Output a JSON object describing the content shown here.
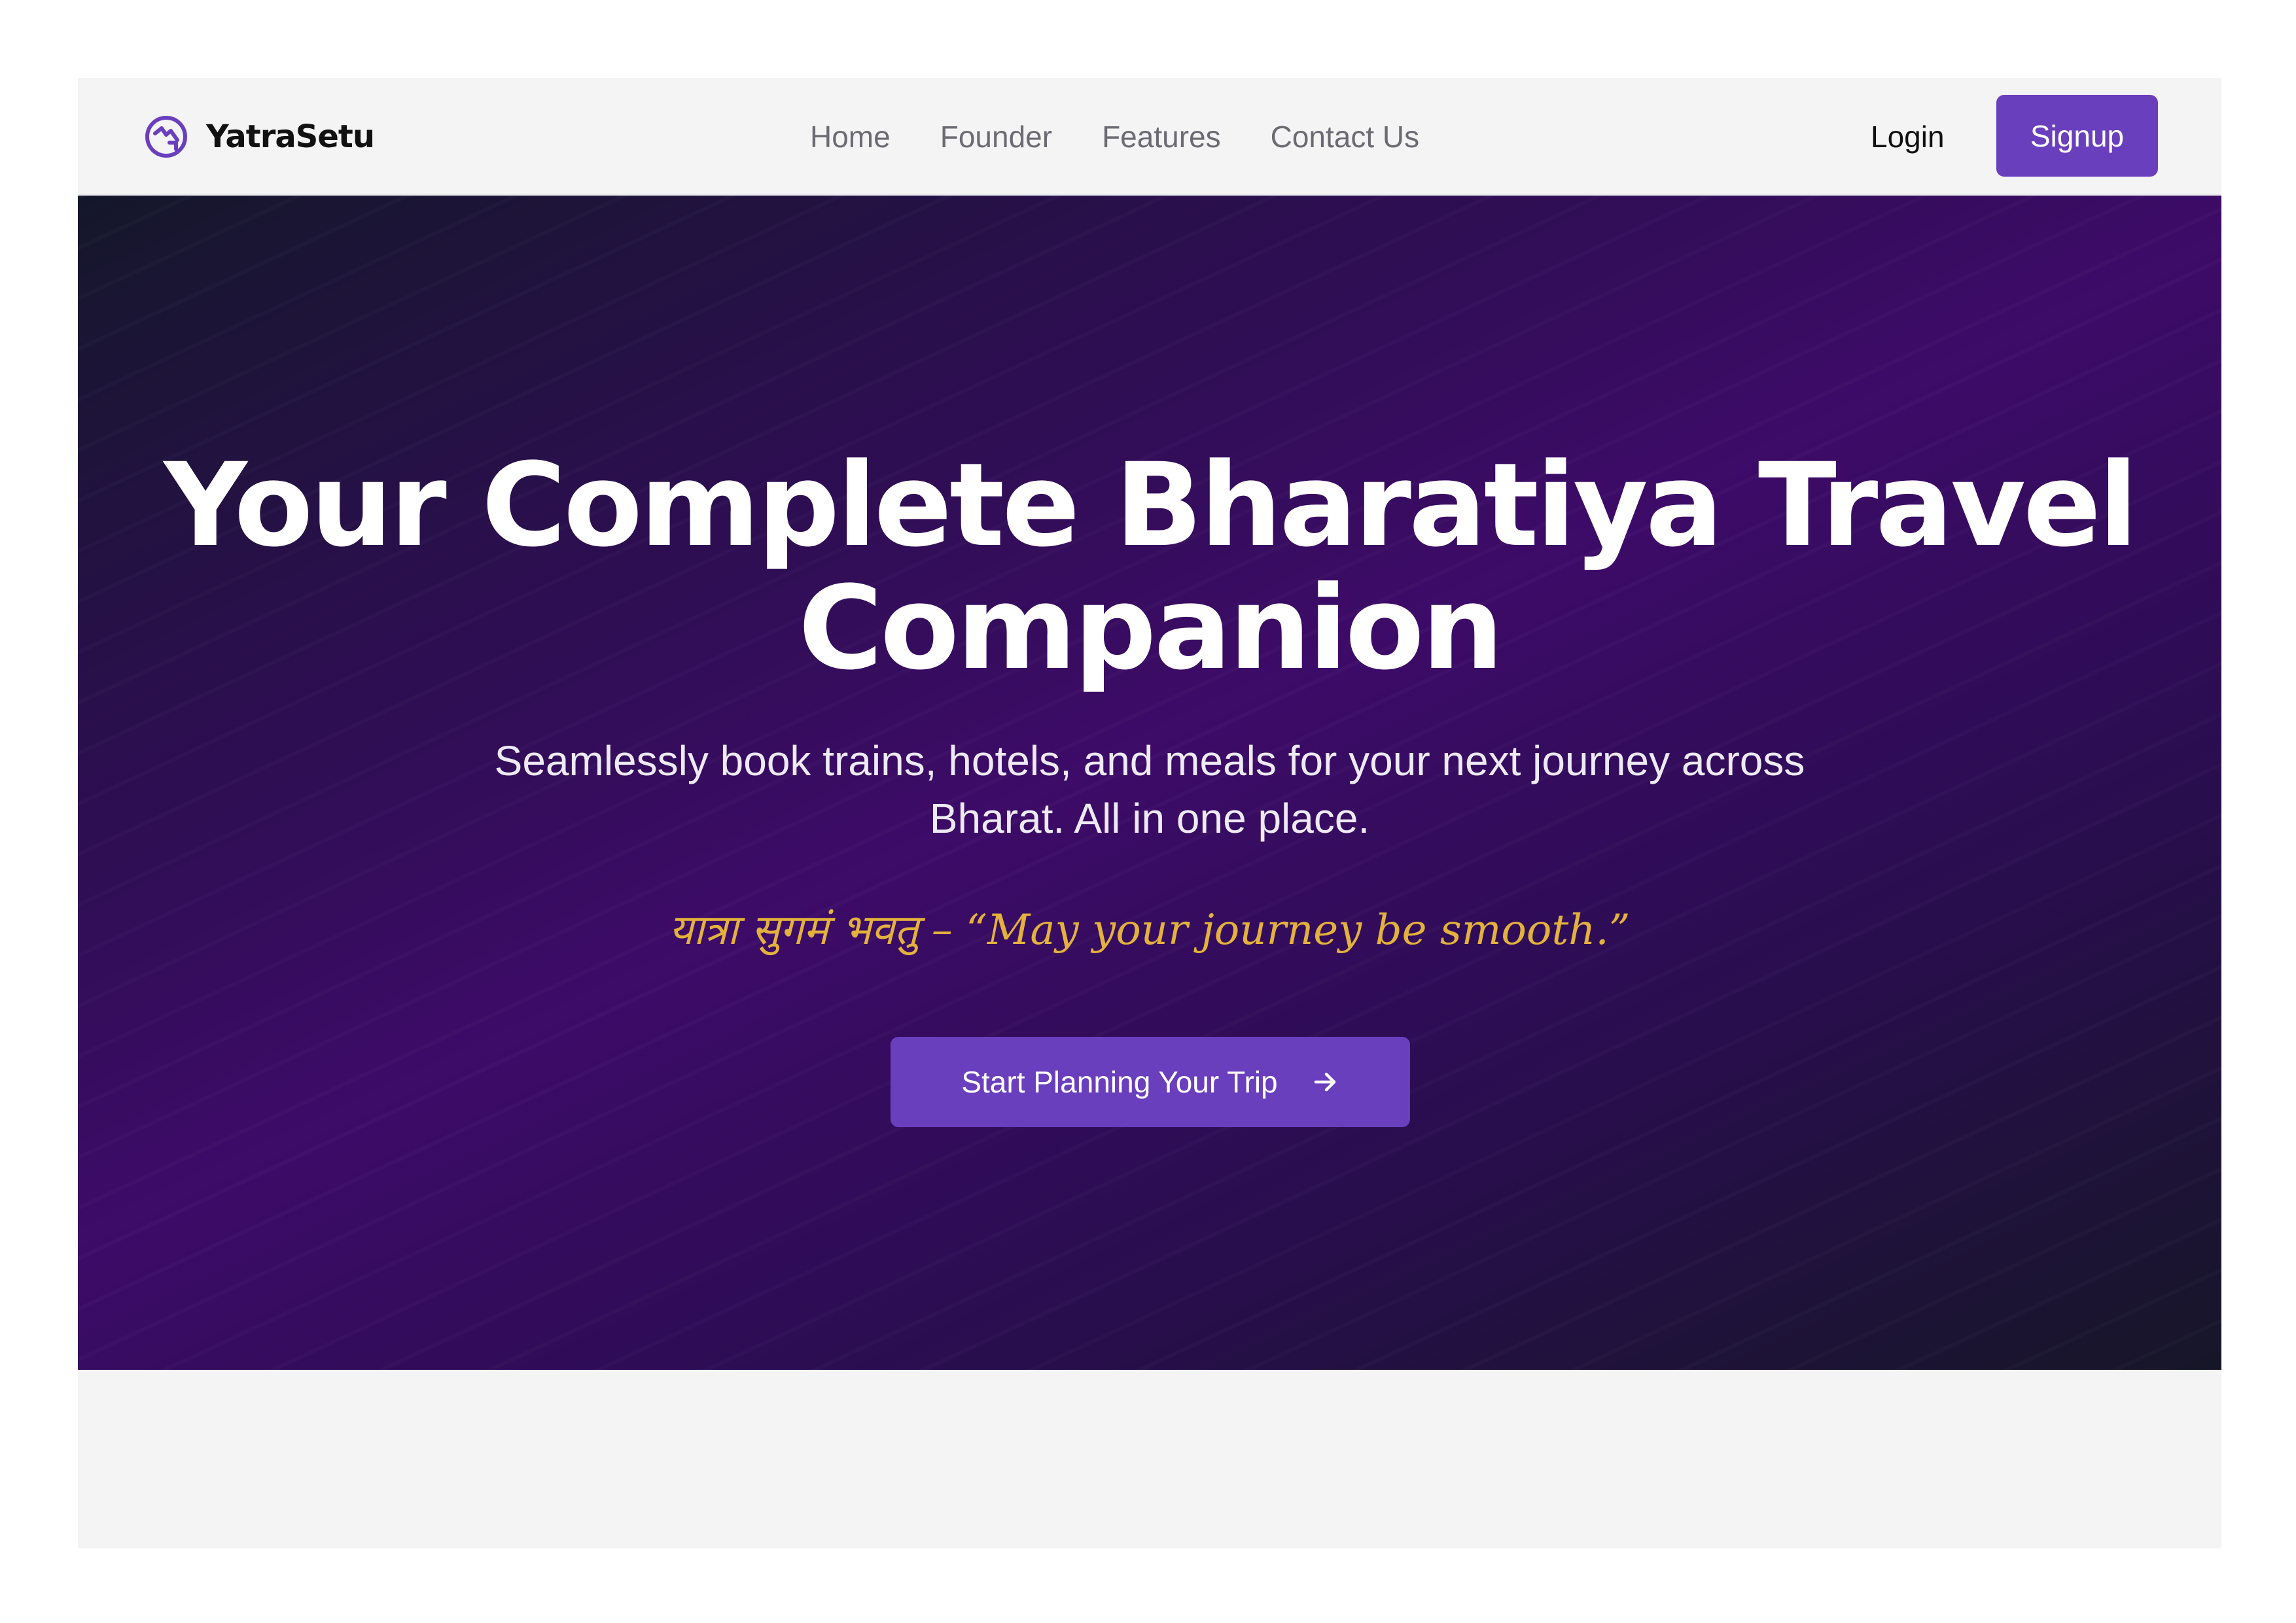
{
  "navbar": {
    "brand": {
      "name": "YatraSetu",
      "icon": "compass-logo-icon"
    },
    "links": [
      "Home",
      "Founder",
      "Features",
      "Contact Us"
    ],
    "login_label": "Login",
    "signup_label": "Signup"
  },
  "hero": {
    "title": "Your Complete Bharatiya Travel Companion",
    "subtitle": "Seamlessly book trains, hotels, and meals for your next journey across Bharat. All in one place.",
    "quote": "यात्रा सुगमं भवतु – “May your journey be smooth.”",
    "cta_label": "Start Planning Your Trip",
    "cta_icon": "arrow-right-icon"
  },
  "colors": {
    "accent": "#6a3fbd",
    "quote": "#e3b23c",
    "hero_dark": "#14172a",
    "hero_purple": "#3d0b68",
    "page_bg": "#f4f4f5"
  }
}
